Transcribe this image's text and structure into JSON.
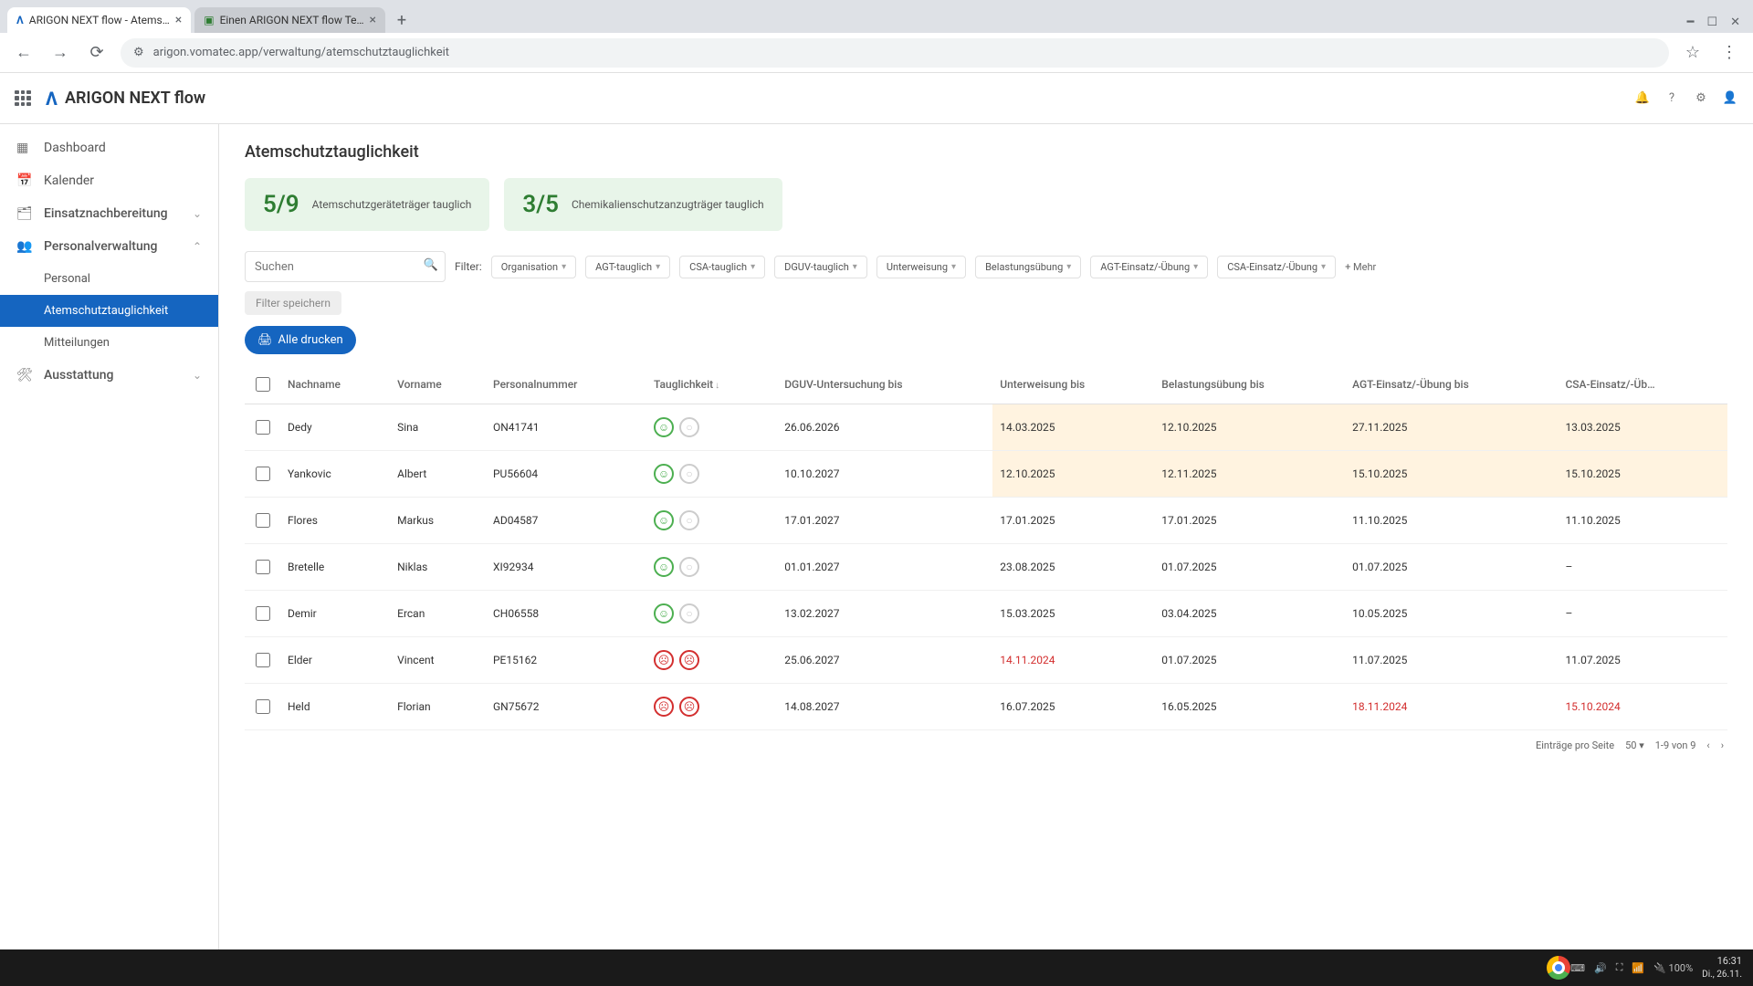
{
  "browser": {
    "tabs": [
      {
        "title": "ARIGON NEXT flow - Atems…"
      },
      {
        "title": "Einen ARIGON NEXT flow Te…"
      }
    ],
    "url": "arigon.vomatec.app/verwaltung/atemschutztauglichkeit"
  },
  "app": {
    "title": "ARIGON NEXT flow"
  },
  "sidebar": {
    "items": [
      {
        "icon": "dashboard",
        "label": "Dashboard"
      },
      {
        "icon": "calendar",
        "label": "Kalender"
      },
      {
        "icon": "deploy",
        "label": "Einsatznachbereitung",
        "expandable": true
      },
      {
        "icon": "people",
        "label": "Personalverwaltung",
        "expandable": true,
        "open": true,
        "children": [
          {
            "label": "Personal"
          },
          {
            "label": "Atemschutztauglichkeit",
            "active": true
          },
          {
            "label": "Mitteilungen"
          }
        ]
      },
      {
        "icon": "equip",
        "label": "Ausstattung",
        "expandable": true
      }
    ]
  },
  "page": {
    "title": "Atemschutztauglichkeit",
    "cards": [
      {
        "value": "5/9",
        "label": "Atemschutzgeräteträger tauglich"
      },
      {
        "value": "3/5",
        "label": "Chemikalienschutzanzugträger tauglich"
      }
    ],
    "search_placeholder": "Suchen",
    "filter_label": "Filter:",
    "filter_save": "Filter speichern",
    "filters": [
      "Organisation",
      "AGT-tauglich",
      "CSA-tauglich",
      "DGUV-tauglich",
      "Unterweisung",
      "Belastungsübung",
      "AGT-Einsatz/-Übung",
      "CSA-Einsatz/-Übung"
    ],
    "filter_more": "Mehr",
    "print_all": "Alle drucken",
    "columns": [
      "Nachname",
      "Vorname",
      "Personalnummer",
      "Tauglichkeit",
      "DGUV-Untersuchung bis",
      "Unterweisung bis",
      "Belastungsübung bis",
      "AGT-Einsatz/-Übung bis",
      "CSA-Einsatz/-Üb…"
    ],
    "rows": [
      {
        "last": "Dedy",
        "first": "Sina",
        "num": "ON41741",
        "agt": "ok",
        "csa": "off",
        "dguv": "26.06.2026",
        "unt": "14.03.2025",
        "bel": "12.10.2025",
        "agte": "27.11.2025",
        "csae": "13.03.2025",
        "warn": true
      },
      {
        "last": "Yankovic",
        "first": "Albert",
        "num": "PU56604",
        "agt": "ok",
        "csa": "off",
        "dguv": "10.10.2027",
        "unt": "12.10.2025",
        "bel": "12.11.2025",
        "agte": "15.10.2025",
        "csae": "15.10.2025",
        "warn": true
      },
      {
        "last": "Flores",
        "first": "Markus",
        "num": "AD04587",
        "agt": "ok",
        "csa": "off",
        "dguv": "17.01.2027",
        "unt": "17.01.2025",
        "bel": "17.01.2025",
        "agte": "11.10.2025",
        "csae": "11.10.2025"
      },
      {
        "last": "Bretelle",
        "first": "Niklas",
        "num": "XI92934",
        "agt": "ok",
        "csa": "off",
        "dguv": "01.01.2027",
        "unt": "23.08.2025",
        "bel": "01.07.2025",
        "agte": "01.07.2025",
        "csae": "–"
      },
      {
        "last": "Demir",
        "first": "Ercan",
        "num": "CH06558",
        "agt": "ok",
        "csa": "off",
        "dguv": "13.02.2027",
        "unt": "15.03.2025",
        "bel": "03.04.2025",
        "agte": "10.05.2025",
        "csae": "–"
      },
      {
        "last": "Elder",
        "first": "Vincent",
        "num": "PE15162",
        "agt": "bad",
        "csa": "bad",
        "dguv": "25.06.2027",
        "unt": "14.11.2024",
        "unt_warn": true,
        "bel": "01.07.2025",
        "agte": "11.07.2025",
        "csae": "11.07.2025"
      },
      {
        "last": "Held",
        "first": "Florian",
        "num": "GN75672",
        "agt": "bad",
        "csa": "bad",
        "dguv": "14.08.2027",
        "unt": "16.07.2025",
        "bel": "16.05.2025",
        "agte": "18.11.2024",
        "agte_warn": true,
        "csae": "15.10.2024",
        "csae_warn": true
      }
    ],
    "pager": {
      "label": "Einträge pro Seite",
      "size": "50",
      "range": "1-9 von 9"
    }
  },
  "taskbar": {
    "time": "16:31",
    "date": "Di., 26.11.",
    "battery": "100%"
  }
}
